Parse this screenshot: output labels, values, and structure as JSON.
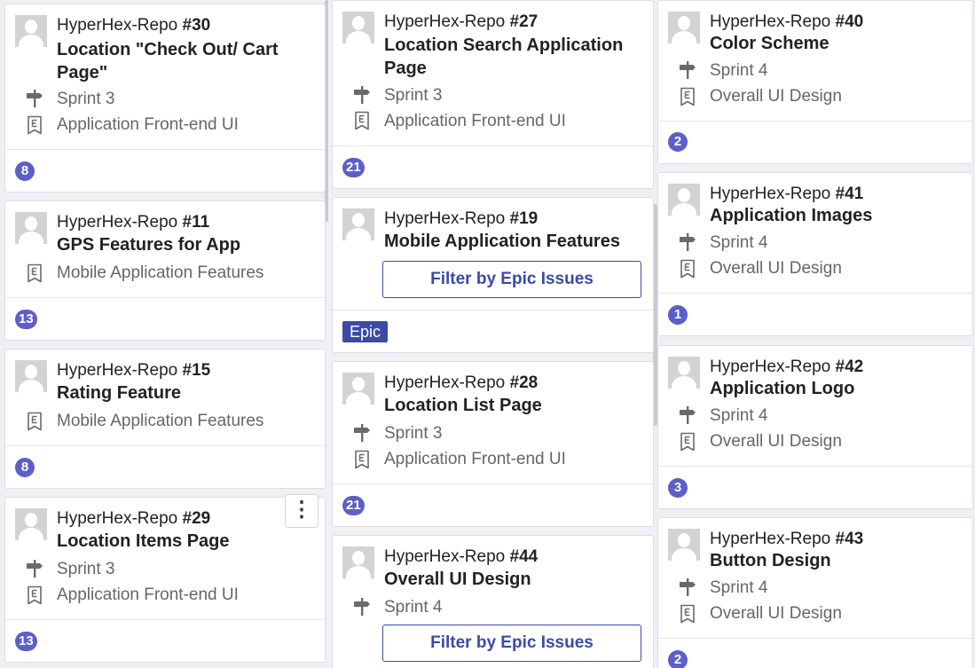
{
  "repo_name": "HyperHex-Repo",
  "filter_label": "Filter by Epic Issues",
  "epic_label": "Epic",
  "accent": "#5b5fc7",
  "cards": {
    "c30": {
      "number": "#30",
      "title1": "Location \"Check Out/ Cart",
      "title2": "Page\"",
      "milestone": "Sprint 3",
      "epic": "Application Front-end UI",
      "estimate": "8"
    },
    "c11": {
      "number": "#11",
      "title": "GPS Features for App",
      "epic": "Mobile Application Features",
      "estimate": "13"
    },
    "c15": {
      "number": "#15",
      "title": "Rating Feature",
      "epic": "Mobile Application Features",
      "estimate": "8"
    },
    "c29": {
      "number": "#29",
      "title": "Location Items Page",
      "milestone": "Sprint 3",
      "epic": "Application Front-end UI",
      "estimate": "13",
      "menu": "⋮"
    },
    "c27": {
      "number": "#27",
      "title1": "Location Search Application",
      "title2": "Page",
      "milestone": "Sprint 3",
      "epic": "Application Front-end UI",
      "estimate": "21"
    },
    "c19": {
      "number": "#19",
      "title": "Mobile Application Features"
    },
    "c28": {
      "number": "#28",
      "title": "Location List Page",
      "milestone": "Sprint 3",
      "epic": "Application Front-end UI",
      "estimate": "21"
    },
    "c44": {
      "number": "#44",
      "title": "Overall UI Design",
      "milestone": "Sprint 4"
    },
    "c40": {
      "number": "#40",
      "title": "Color Scheme",
      "milestone": "Sprint 4",
      "epic": "Overall UI Design",
      "estimate": "2"
    },
    "c41": {
      "number": "#41",
      "title": "Application Images",
      "milestone": "Sprint 4",
      "epic": "Overall UI Design",
      "estimate": "1"
    },
    "c42": {
      "number": "#42",
      "title": "Application Logo",
      "milestone": "Sprint 4",
      "epic": "Overall UI Design",
      "estimate": "3"
    },
    "c43": {
      "number": "#43",
      "title": "Button Design",
      "milestone": "Sprint 4",
      "epic": "Overall UI Design",
      "estimate": "2"
    }
  }
}
